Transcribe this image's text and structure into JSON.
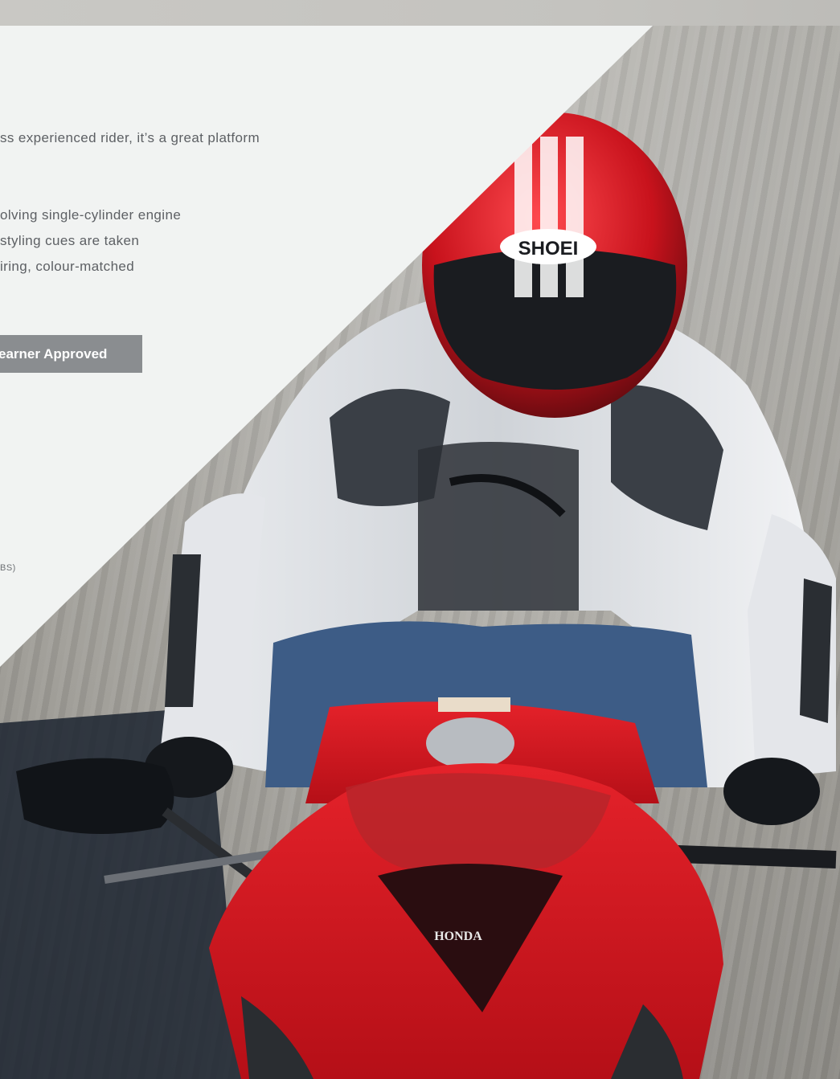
{
  "copy": {
    "line1": "ss experienced rider, it’s a great platform",
    "line2": "olving single-cylinder engine",
    "line3": "styling cues are taken",
    "line4": "iring, colour-matched"
  },
  "badge": {
    "label": "earner Approved"
  },
  "spec_note": "BS)",
  "photo": {
    "helmet_brand": "SHOEI",
    "bike_brand": "HONDA"
  },
  "colors": {
    "panel": "#f1f3f2",
    "text": "#5d6064",
    "badge": "#8a8d90",
    "bike_red": "#d7131c"
  }
}
